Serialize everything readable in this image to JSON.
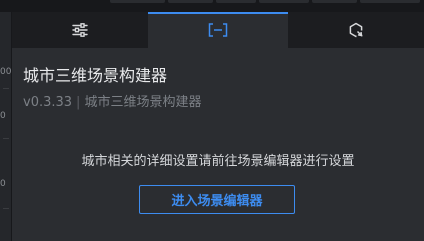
{
  "colors": {
    "accent": "#3d8cf0",
    "tab_icon": "#d8d9db"
  },
  "left_ruler": {
    "ticks": [
      "00",
      "0",
      "0"
    ]
  },
  "tabs": [
    {
      "icon": "sliders-icon",
      "active": false
    },
    {
      "icon": "scene-editor-icon",
      "active": true
    },
    {
      "icon": "refresh-icon",
      "active": false
    }
  ],
  "panel": {
    "title": "城市三维场景构建器",
    "version": "v0.3.33",
    "separator": "|",
    "subtitle_name": "城市三维场景构建器",
    "description": "城市相关的详细设置请前往场景编辑器进行设置",
    "enter_button_label": "进入场景编辑器"
  }
}
